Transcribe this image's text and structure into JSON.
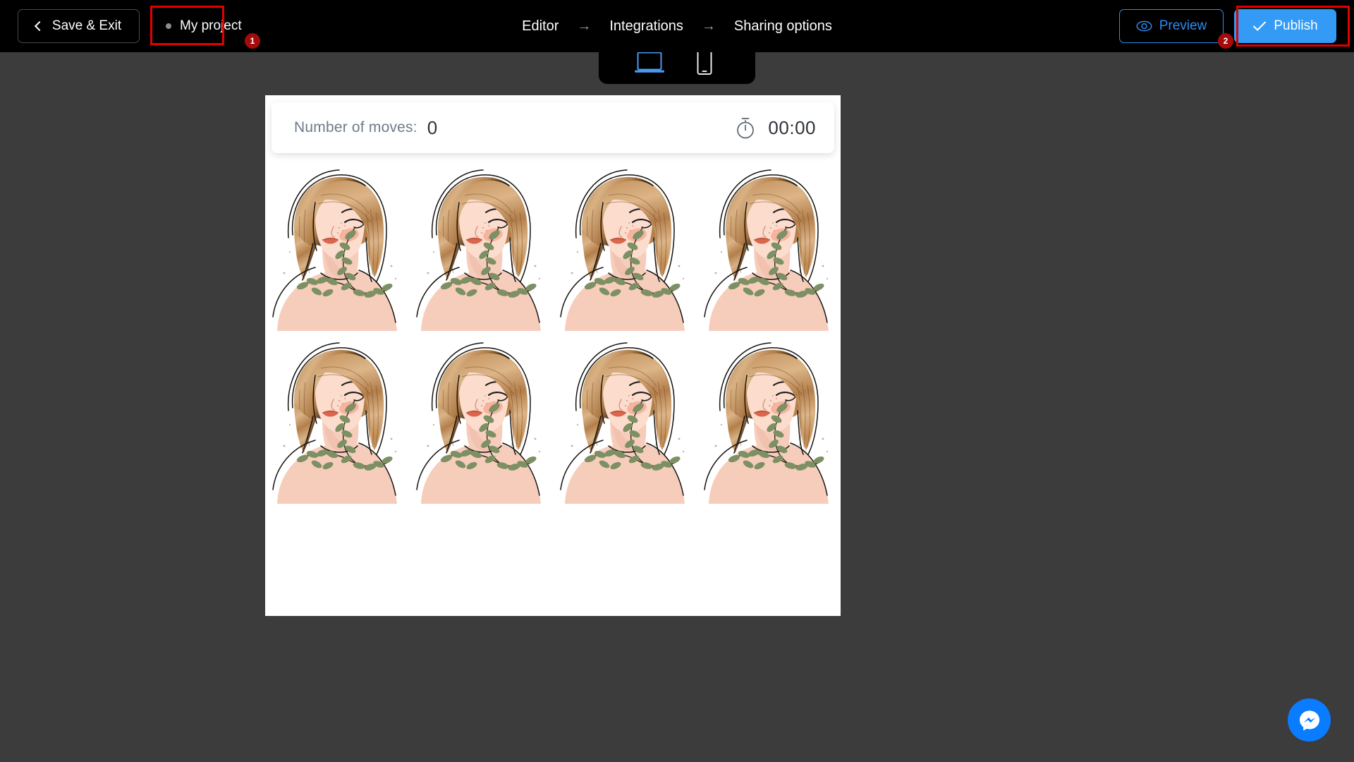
{
  "topbar": {
    "save_exit_label": "Save & Exit",
    "project_name": "My project",
    "preview_label": "Preview",
    "publish_label": "Publish",
    "breadcrumb": [
      {
        "label": "Editor"
      },
      {
        "label": "Integrations"
      },
      {
        "label": "Sharing options"
      }
    ],
    "breadcrumb_separator": "→"
  },
  "device_switcher": {
    "desktop_icon": "desktop-icon",
    "mobile_icon": "mobile-icon",
    "active": "desktop"
  },
  "annotations": [
    {
      "badge": "1",
      "target": "project-chip"
    },
    {
      "badge": "2",
      "target": "publish-button"
    }
  ],
  "canvas": {
    "stats": {
      "moves_label": "Number of moves:",
      "moves_value": "0",
      "timer_icon": "stopwatch-icon",
      "timer_value": "00:00"
    },
    "grid": {
      "columns": 4,
      "rows": 2,
      "cards": [
        {
          "id": "card-1",
          "image": "woman-with-leaves-illustration"
        },
        {
          "id": "card-2",
          "image": "woman-with-leaves-illustration"
        },
        {
          "id": "card-3",
          "image": "woman-with-leaves-illustration"
        },
        {
          "id": "card-4",
          "image": "woman-with-leaves-illustration"
        },
        {
          "id": "card-5",
          "image": "woman-with-leaves-illustration"
        },
        {
          "id": "card-6",
          "image": "woman-with-leaves-illustration"
        },
        {
          "id": "card-7",
          "image": "woman-with-leaves-illustration"
        },
        {
          "id": "card-8",
          "image": "woman-with-leaves-illustration"
        }
      ]
    }
  },
  "chat_widget": {
    "icon": "messenger-icon"
  },
  "colors": {
    "topbar_bg": "#000000",
    "page_bg": "#3c3c3c",
    "canvas_bg": "#ffffff",
    "accent_blue": "#339af5",
    "preview_blue": "#2d8bf0",
    "annotation_red": "#e00000",
    "badge_red": "#a50b0b",
    "messenger_blue": "#0a7cff"
  }
}
